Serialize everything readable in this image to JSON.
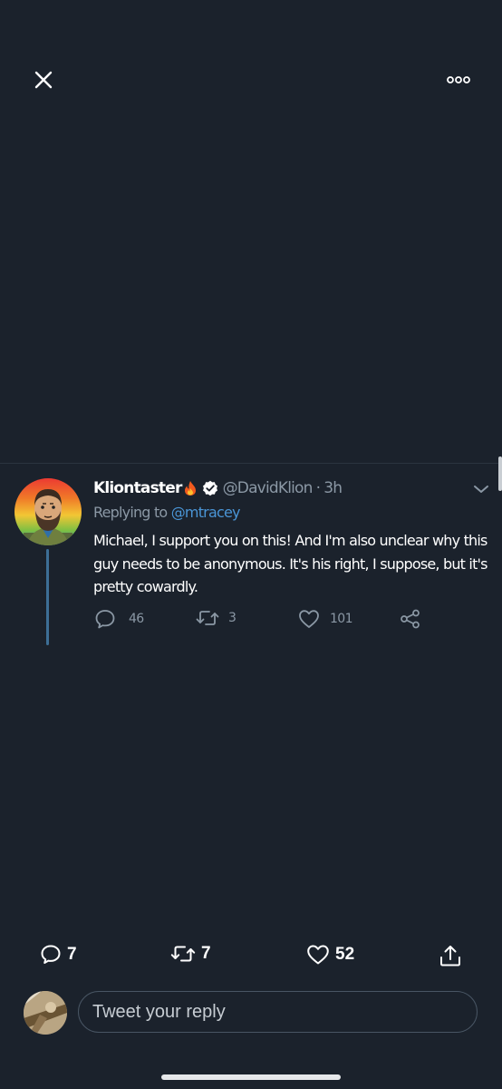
{
  "header": {
    "close_icon": "close-icon",
    "more_icon": "more-options-icon"
  },
  "tweet": {
    "display_name": "Kliontaster",
    "name_emoji": "fire-emoji",
    "verified_icon": "verified-badge-icon",
    "handle": "@DavidKlion",
    "separator": "·",
    "time": "3h",
    "replying_to_label": "Replying to",
    "replying_to_handle": "@mtracey",
    "text": "Michael, I support you on this! And I'm also unclear why this guy needs to be anonymous. It's his right, I suppose, but it's pretty cowardly.",
    "actions": {
      "reply_count": "46",
      "retweet_count": "3",
      "like_count": "101",
      "share_icon": "share-icon"
    },
    "menu_icon": "chevron-down-icon"
  },
  "footer": {
    "reply_count": "7",
    "retweet_count": "7",
    "like_count": "52",
    "upload_icon": "upload-share-icon",
    "reply_placeholder": "Tweet your reply"
  },
  "colors": {
    "background": "#1b222c",
    "accent": "#4a95d6",
    "muted_text": "#8b98a5",
    "thread_line": "#3d6f96"
  }
}
